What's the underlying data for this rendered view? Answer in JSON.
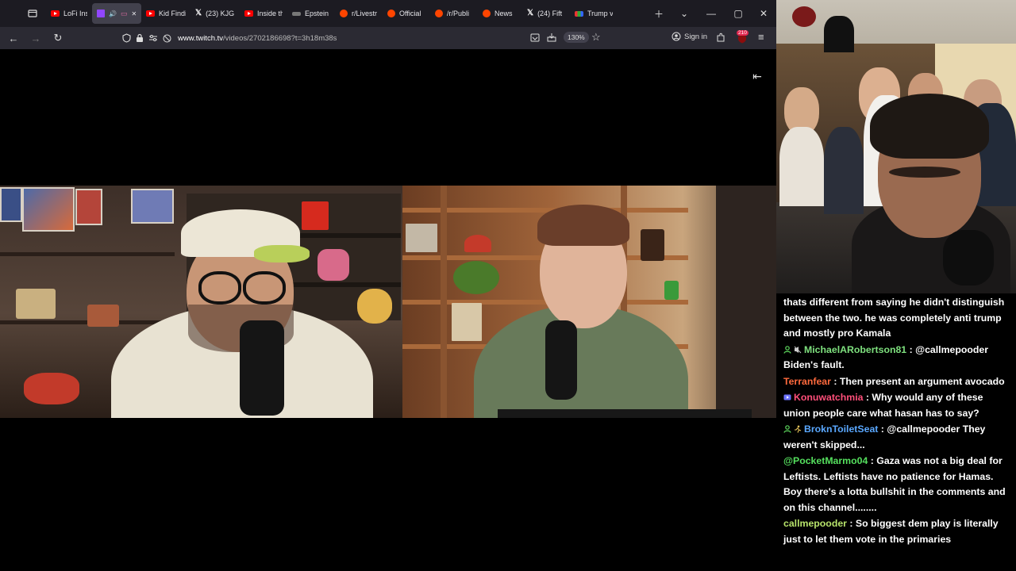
{
  "browser": {
    "tabs": [
      {
        "label": "LoFi Insi",
        "icon": "youtube-icon",
        "active": false
      },
      {
        "label": "",
        "icon": "twitch-icon",
        "active": true
      },
      {
        "label": "Kid Findi",
        "icon": "youtube-icon",
        "active": false
      },
      {
        "label": "(23) KJG",
        "icon": "x-icon",
        "active": false
      },
      {
        "label": "Inside th",
        "icon": "youtube-icon",
        "active": false
      },
      {
        "label": "Epstein",
        "icon": "epstein-icon",
        "active": false
      },
      {
        "label": "r/Livestr",
        "icon": "reddit-icon",
        "active": false
      },
      {
        "label": "Official",
        "icon": "reddit-icon",
        "active": false
      },
      {
        "label": "/r/Publi",
        "icon": "reddit-icon",
        "active": false
      },
      {
        "label": "News",
        "icon": "reddit-icon",
        "active": false
      },
      {
        "label": "(24) Fift",
        "icon": "x-icon",
        "active": false
      },
      {
        "label": "Trump v",
        "icon": "news-icon",
        "active": false
      }
    ],
    "url_host": "www.twitch.tv",
    "url_path": "/videos/2702186698?t=3h18m38s",
    "zoom": "130%",
    "sign_in": "Sign in",
    "extension_badge": "210"
  },
  "chat": {
    "messages": [
      {
        "user": "",
        "user_color": "#ffffff",
        "text": "thats different from saying he didn't distinguish between the two. he was completely anti trump and mostly pro Kamala"
      },
      {
        "user": "MichaelARobertson81",
        "user_color": "#7ee07e",
        "badges": [
          "person-badge",
          "noaudio-badge"
        ],
        "text": "@callmepooder Biden's fault."
      },
      {
        "user": "Terranfear",
        "user_color": "#ff6a3d",
        "text": "Then present an argument avocado"
      },
      {
        "user": "Konuwatchmia",
        "user_color": "#ff4f7a",
        "badges": [
          "video-badge"
        ],
        "text": "Why would any of these union people care what hasan has to say?"
      },
      {
        "user": "BroknToiletSeat",
        "user_color": "#5aa8ff",
        "badges": [
          "person-badge",
          "runner-badge"
        ],
        "text": "@callmepooder They weren't skipped..."
      },
      {
        "user": "@PocketMarmo04",
        "user_color": "#55e05e",
        "text": "Gaza was not a big deal for Leftists. Leftists have no patience for Hamas. Boy there's a lotta bullshit in the comments and on this channel........"
      },
      {
        "user": "callmepooder",
        "user_color": "#b7e36b",
        "text": "So biggest dem play is literally just to let them vote in the primaries"
      }
    ]
  }
}
